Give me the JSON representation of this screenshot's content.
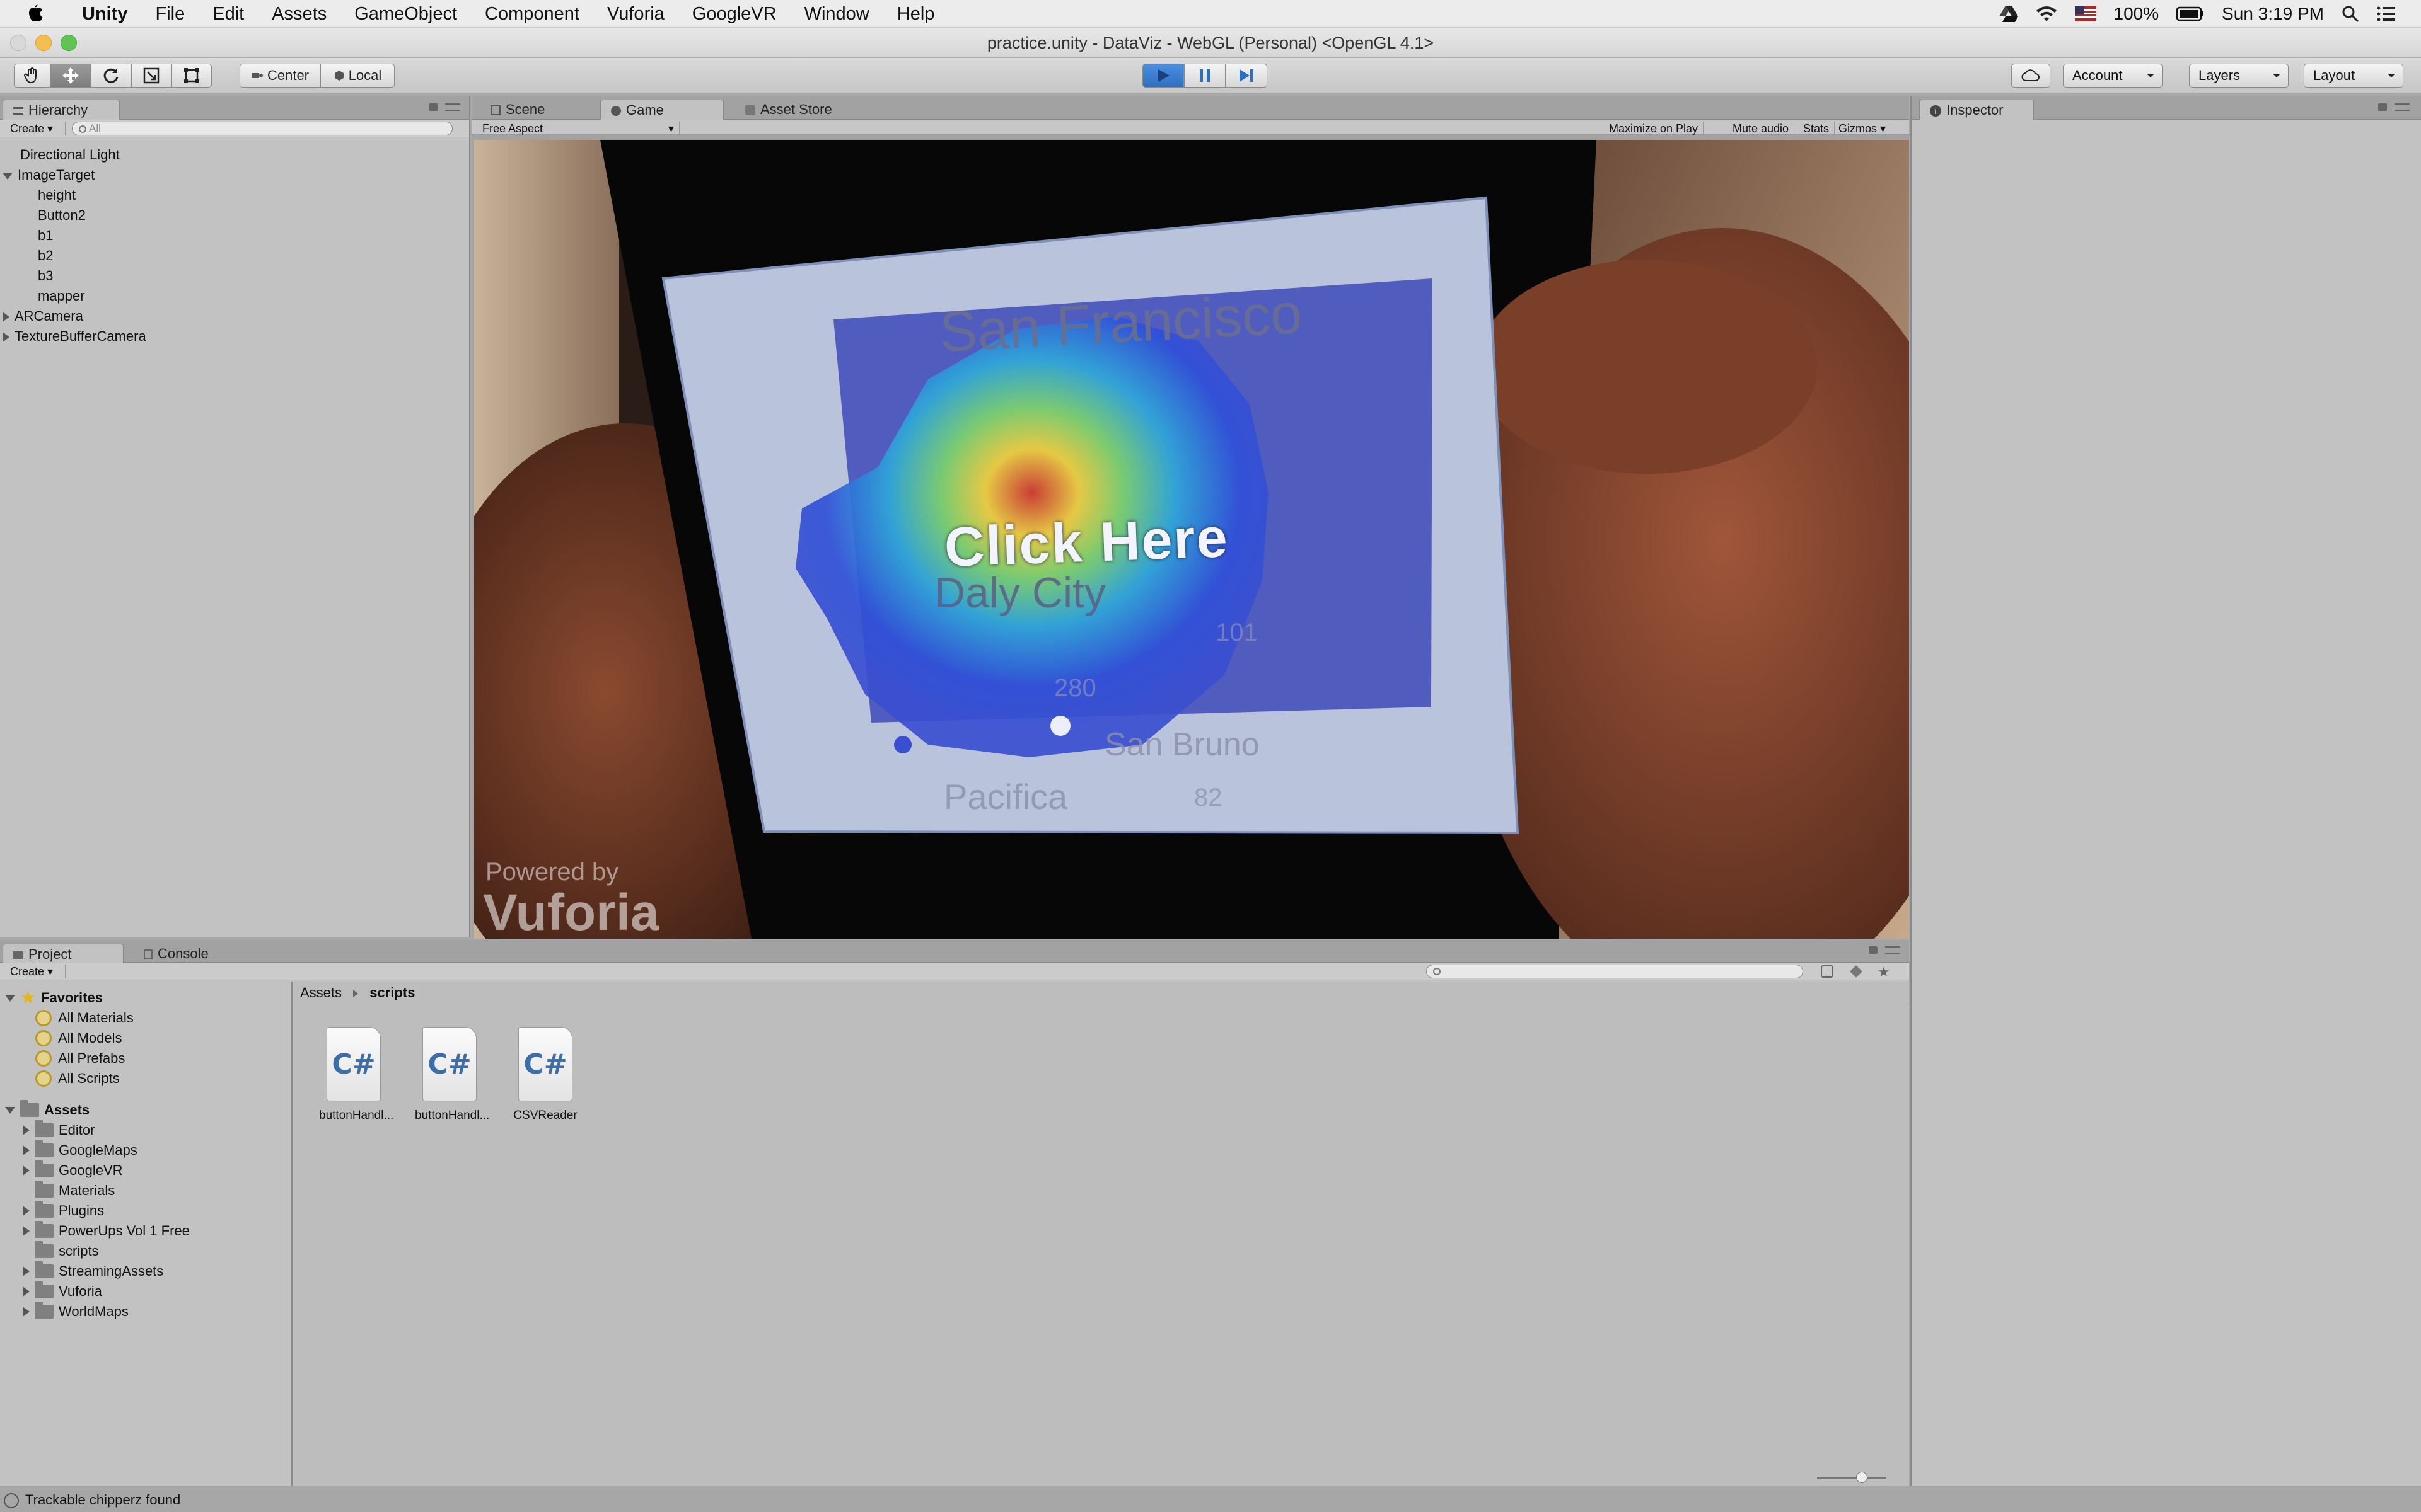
{
  "menubar": {
    "items": [
      "Unity",
      "File",
      "Edit",
      "Assets",
      "GameObject",
      "Component",
      "Vuforia",
      "GoogleVR",
      "Window",
      "Help"
    ],
    "battery": "100%",
    "clock": "Sun 3:19 PM"
  },
  "window": {
    "title": "practice.unity - DataViz - WebGL (Personal) <OpenGL 4.1>"
  },
  "toolbar": {
    "pivot_label": "Center",
    "space_label": "Local",
    "account_label": "Account",
    "layers_label": "Layers",
    "layout_label": "Layout",
    "play_state": "playing"
  },
  "hierarchy": {
    "tab": "Hierarchy",
    "create_label": "Create",
    "search_placeholder": "All",
    "items": [
      {
        "label": "Directional Light",
        "indent": 0,
        "arrow": "none"
      },
      {
        "label": "ImageTarget",
        "indent": 0,
        "arrow": "down"
      },
      {
        "label": "height",
        "indent": 1,
        "arrow": "none"
      },
      {
        "label": "Button2",
        "indent": 1,
        "arrow": "none"
      },
      {
        "label": "b1",
        "indent": 1,
        "arrow": "none"
      },
      {
        "label": "b2",
        "indent": 1,
        "arrow": "none"
      },
      {
        "label": "b3",
        "indent": 1,
        "arrow": "none"
      },
      {
        "label": "mapper",
        "indent": 1,
        "arrow": "none"
      },
      {
        "label": "ARCamera",
        "indent": 0,
        "arrow": "right"
      },
      {
        "label": "TextureBufferCamera",
        "indent": 0,
        "arrow": "right"
      }
    ]
  },
  "center_tabs": {
    "tabs": [
      "Scene",
      "Game",
      "Asset Store"
    ],
    "selected": "Game",
    "aspect_label": "Free Aspect",
    "maximize_label": "Maximize on Play",
    "mute_label": "Mute audio",
    "stats_label": "Stats",
    "gizmos_label": "Gizmos"
  },
  "game": {
    "map_city_top": "San Francisco",
    "map_city_mid": "Daly City",
    "map_city_bottom": "Pacifica",
    "map_city_bottom_right": "San Bruno",
    "road_101": "101",
    "road_280": "280",
    "road_82": "82",
    "button_text": "Click Here",
    "watermark_small": "Powered by",
    "watermark_big": "Vuforia"
  },
  "inspector": {
    "tab": "Inspector"
  },
  "project": {
    "tabs": [
      "Project",
      "Console"
    ],
    "create_label": "Create",
    "favorites_label": "Favorites",
    "favorites": [
      "All Materials",
      "All Models",
      "All Prefabs",
      "All Scripts"
    ],
    "assets_label": "Assets",
    "folders": [
      {
        "label": "Editor",
        "arrow": true
      },
      {
        "label": "GoogleMaps",
        "arrow": true
      },
      {
        "label": "GoogleVR",
        "arrow": true
      },
      {
        "label": "Materials",
        "arrow": false
      },
      {
        "label": "Plugins",
        "arrow": true
      },
      {
        "label": "PowerUps Vol 1 Free",
        "arrow": true
      },
      {
        "label": "scripts",
        "arrow": false
      },
      {
        "label": "StreamingAssets",
        "arrow": true
      },
      {
        "label": "Vuforia",
        "arrow": true
      },
      {
        "label": "WorldMaps",
        "arrow": true
      }
    ],
    "breadcrumb": [
      "Assets",
      "scripts"
    ],
    "files": [
      {
        "name": "buttonHandl...",
        "icon": "C#"
      },
      {
        "name": "buttonHandl...",
        "icon": "C#"
      },
      {
        "name": "CSVReader",
        "icon": "C#"
      }
    ]
  },
  "status": {
    "message": "Trackable chipperz found"
  }
}
